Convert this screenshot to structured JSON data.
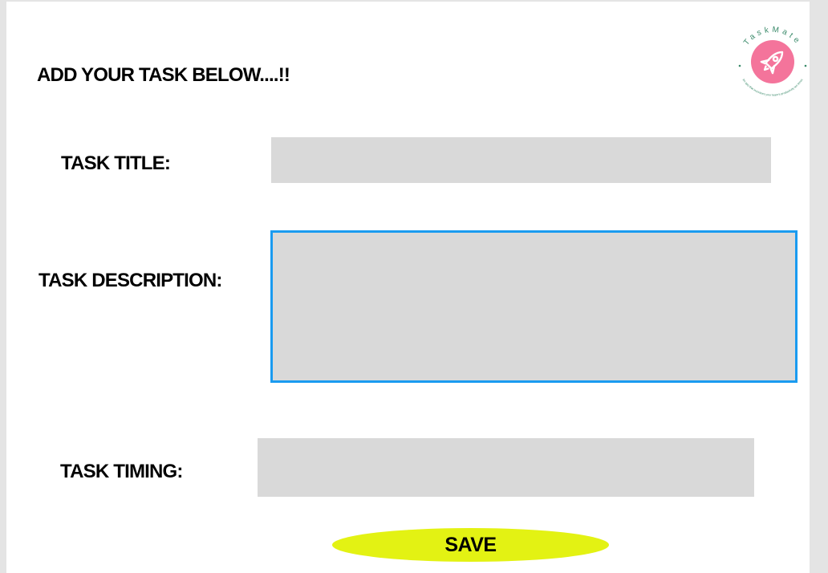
{
  "heading": "ADD YOUR TASK BELOW....!!",
  "form": {
    "title_label": "TASK TITLE:",
    "title_value": "",
    "description_label": "TASK DESCRIPTION:",
    "description_value": "",
    "timing_label": "TASK TIMING:",
    "timing_value": "",
    "save_label": "SAVE"
  },
  "logo": {
    "name": "TaskMate",
    "tagline": "An app that increases your team's productivity ten times",
    "icon": "rocket-icon"
  },
  "colors": {
    "field_bg": "#d9d9d9",
    "focus_border": "#1a9bf0",
    "save_button": "#e3f213",
    "logo_accent": "#f4749b",
    "logo_text": "#3a8a6a"
  }
}
